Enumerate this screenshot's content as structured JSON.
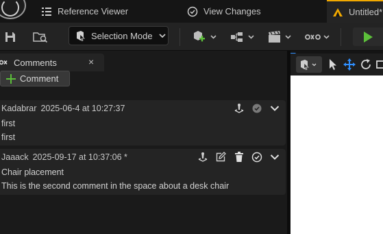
{
  "tabs": [
    {
      "label": "Reference Viewer",
      "icon": "reference-viewer-icon"
    },
    {
      "label": "View Changes",
      "icon": "check-circle-icon"
    },
    {
      "label": "Untitled*",
      "icon": "level-icon"
    }
  ],
  "toolbar": {
    "selection_mode": "Selection Mode"
  },
  "panel": {
    "tab_label": "Comments",
    "close_glyph": "×",
    "add_comment_label": "Comment"
  },
  "comments": [
    {
      "author": "Kadabrar",
      "timestamp": "2025-06-4 at 10:27:37",
      "title": "first",
      "body": "first"
    },
    {
      "author": "Jaaack",
      "timestamp": "2025-09-17 at 10:37:06 *",
      "title": "Chair placement",
      "body": "This is the second comment in the space about a desk chair"
    }
  ],
  "colors": {
    "accent_orange": "#f2a900",
    "play_green": "#5cbf3a",
    "gizmo_blue": "#2f8fff"
  }
}
